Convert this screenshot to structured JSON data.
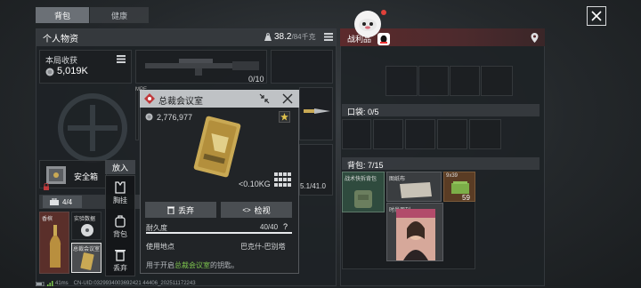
{
  "tabs": [
    {
      "label": "背包",
      "active": true
    },
    {
      "label": "健康",
      "active": false
    }
  ],
  "left_panel": {
    "title": "个人物资",
    "weight": {
      "current": "38.2",
      "max": "/84千克"
    },
    "earnings_label": "本局收获",
    "earnings_value": "5,019K",
    "weapon_ammo": "0/10",
    "mag_text": "5.1/41.0",
    "mpe_label": "MPE"
  },
  "safebox": {
    "label": "安全箱",
    "put_in": "放入",
    "count": "4/4",
    "items": [
      {
        "label": "香槟"
      },
      {
        "label": "实验数据"
      },
      {
        "label": "总裁会议室"
      }
    ]
  },
  "side_menu": [
    {
      "label": "胸挂",
      "icon": "vest-icon"
    },
    {
      "label": "背包",
      "icon": "backpack-icon"
    },
    {
      "label": "丢弃",
      "icon": "trash-icon"
    }
  ],
  "popup": {
    "title": "总裁会议室",
    "price": "2,776,977",
    "weight": "<0.10KG",
    "discard_label": "丢弃",
    "inspect_label": "检视",
    "durability_label": "耐久度",
    "durability_value": "40/40",
    "durability_fraction": 1.0,
    "help": "?",
    "location_label": "使用地点",
    "location_value": "巴克什-巴别塔",
    "description_prefix": "用于开启",
    "description_highlight": "总裁会议室",
    "description_suffix": "的钥匙。"
  },
  "right_panel": {
    "title": "战利品",
    "pocket_label": "口袋: 0/5",
    "backpack_label": "背包: 7/15",
    "items": [
      {
        "label": "战术快拆背包",
        "name": "tactical-bag"
      },
      {
        "label": "图纸布",
        "name": "blueprint-cloth"
      },
      {
        "label": "9x39",
        "count": "59",
        "name": "ammo-9x39"
      },
      {
        "label": "时尚周刊",
        "name": "fashion-magazine"
      }
    ]
  },
  "status_bar": {
    "ping": "41ms",
    "build": "CN-UID:0329934003692421 44406_202511172243"
  },
  "colors": {
    "accent_green": "#7ec64e",
    "accent_red": "#c0393b",
    "gold": "#c9a954",
    "header_red": "#5c2a2c"
  }
}
